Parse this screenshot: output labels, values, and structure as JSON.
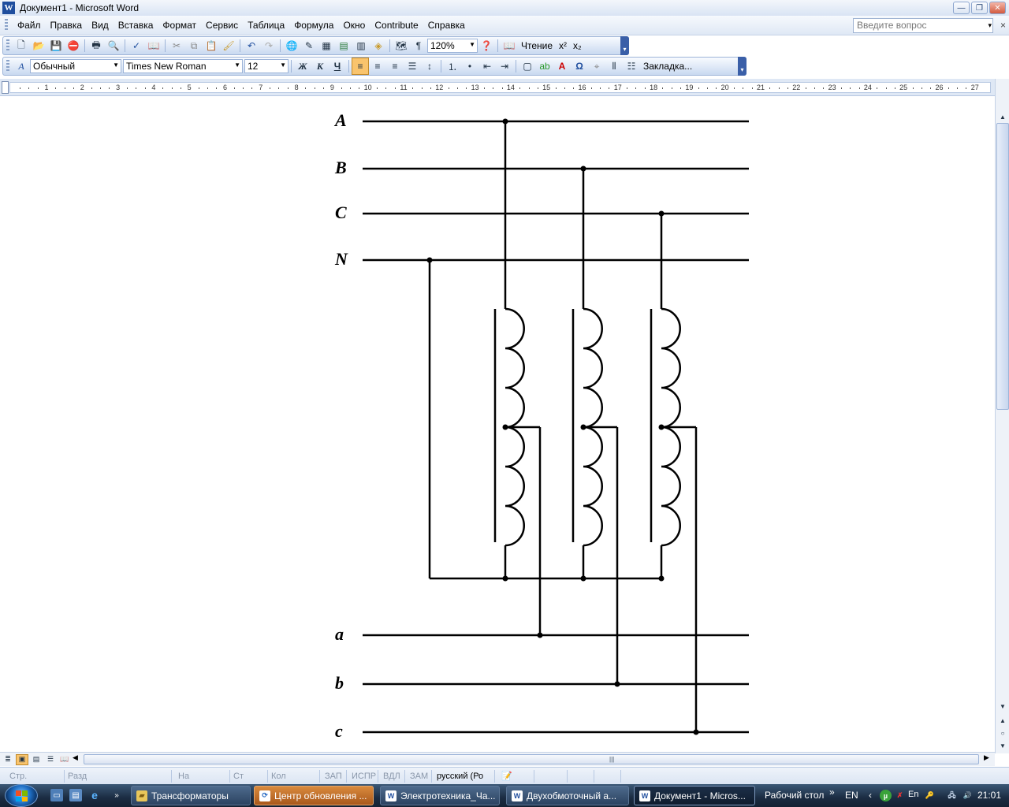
{
  "window": {
    "title": "Документ1 - Microsoft Word",
    "app_icon": "W",
    "buttons": {
      "minimize": "—",
      "restore": "❐",
      "close": "✕"
    }
  },
  "menu": {
    "items": [
      {
        "label": "Файл"
      },
      {
        "label": "Правка"
      },
      {
        "label": "Вид"
      },
      {
        "label": "Вставка"
      },
      {
        "label": "Формат"
      },
      {
        "label": "Сервис"
      },
      {
        "label": "Таблица"
      },
      {
        "label": "Формула"
      },
      {
        "label": "Окно"
      },
      {
        "label": "Contribute"
      },
      {
        "label": "Справка"
      }
    ],
    "question_placeholder": "Введите вопрос",
    "dropdown_arrow": "▾",
    "close_doc": "×"
  },
  "toolbar1": {
    "zoom": "120%",
    "reading_label": "Чтение",
    "superscript": "x²",
    "subscript": "x₂",
    "icons": [
      "new-icon",
      "open-icon",
      "save-icon",
      "permission-icon",
      "print-icon",
      "preview-icon",
      "spelling-icon",
      "research-icon",
      "cut-icon",
      "copy-icon",
      "paste-icon",
      "format-painter-icon",
      "undo-icon",
      "redo-icon",
      "hyperlink-icon",
      "tables-borders-icon",
      "insert-table-icon",
      "insert-excel-icon",
      "columns-icon",
      "drawing-icon",
      "document-map-icon",
      "show-marks-icon",
      "help-icon"
    ]
  },
  "toolbar2": {
    "style": "Обычный",
    "font": "Times New Roman",
    "size": "12",
    "bold": "Ж",
    "italic": "К",
    "underline": "Ч",
    "omega": "Ω",
    "bookmark": "Закладка..."
  },
  "ruler": {
    "numbers": [
      "1",
      "2",
      "3",
      "4",
      "5",
      "6",
      "7",
      "8",
      "9",
      "10",
      "11",
      "12",
      "13",
      "14",
      "15",
      "16",
      "17",
      "18",
      "19",
      "20",
      "21",
      "22",
      "23",
      "24",
      "25",
      "26",
      "27"
    ]
  },
  "diagram": {
    "primary_labels": [
      "A",
      "B",
      "C",
      "N"
    ],
    "secondary_labels": [
      "a",
      "b",
      "c"
    ],
    "phase_count": 3,
    "windings_per_phase": 2,
    "turns_per_winding": 3,
    "connection": "neutral-bus"
  },
  "statusbar": {
    "page": "Стр.",
    "section": "Разд",
    "at": "На",
    "line": "Ст",
    "column": "Кол",
    "rec": "ЗАП",
    "trk": "ИСПР",
    "ext": "ВДЛ",
    "ovr": "ЗАМ",
    "language": "русский (Ро"
  },
  "taskbar": {
    "tasks": [
      {
        "label": "Трансформаторы",
        "icon": "folder-icon"
      },
      {
        "label": "Центр обновления ...",
        "icon": "update-icon"
      },
      {
        "label": "Электротехника_Ча...",
        "icon": "word-icon"
      },
      {
        "label": "Двухобмоточный а...",
        "icon": "word-icon"
      },
      {
        "label": "Документ1 - Micros...",
        "icon": "word-icon"
      }
    ],
    "desktop_label": "Рабочий стол",
    "more": "»",
    "lang": "EN",
    "tray_back": "‹",
    "en_small": "En",
    "clock": "21:01"
  },
  "colors": {
    "accent": "#3a5fa8",
    "active_button": "#f9c46d",
    "taskbar_highlight": "#d98a3d"
  }
}
